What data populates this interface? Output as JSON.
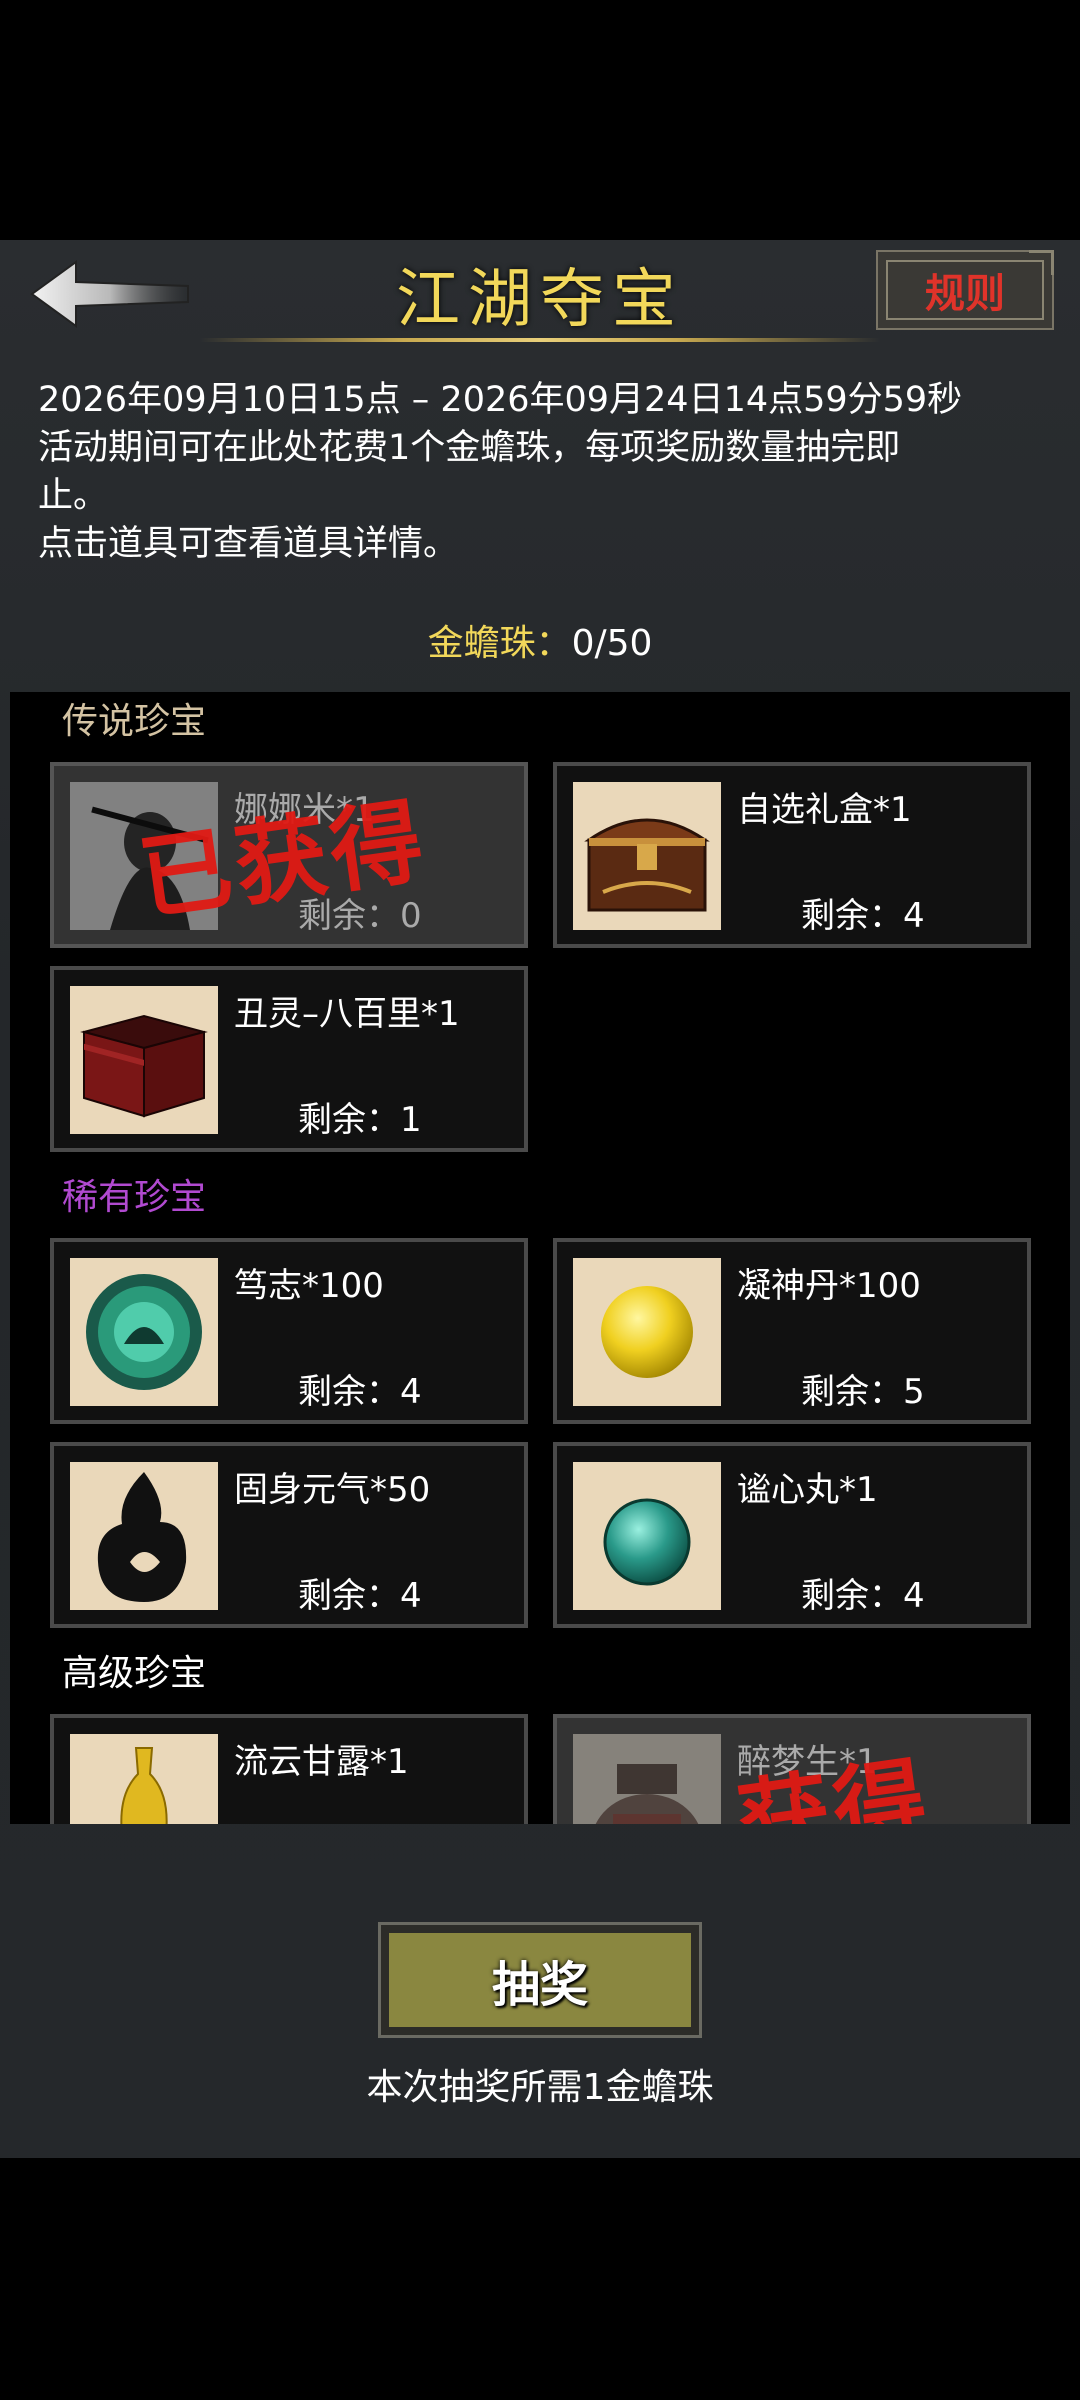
{
  "header": {
    "title": "江湖夺宝",
    "rules_label": "规则"
  },
  "info": {
    "date_range": "2026年09月10日15点 – 2026年09月24日14点59分59秒",
    "desc_line1": "活动期间可在此处花费1个金蟾珠，每项奖励数量抽完即",
    "desc_line2": "止。",
    "tip": "点击道具可查看道具详情。"
  },
  "currency": {
    "label": "金蟾珠：",
    "value": "0/50"
  },
  "sections": {
    "legend": {
      "title": "传说珍宝",
      "color": "#d4c3a3",
      "items": [
        {
          "name": "娜娜米*1",
          "remain": "剩余：0",
          "stamp": "已获得",
          "icon": "ninja-portrait"
        },
        {
          "name": "自选礼盒*1",
          "remain": "剩余：4",
          "icon": "treasure-chest"
        },
        {
          "name": "丑灵–八百里*1",
          "remain": "剩余：1",
          "icon": "red-box"
        }
      ]
    },
    "rare": {
      "title": "稀有珍宝",
      "color": "#b14ad0",
      "items": [
        {
          "name": "笃志*100",
          "remain": "剩余：4",
          "icon": "jade-orb"
        },
        {
          "name": "凝神丹*100",
          "remain": "剩余：5",
          "icon": "gold-pill"
        },
        {
          "name": "固身元气*50",
          "remain": "剩余：4",
          "icon": "black-flame"
        },
        {
          "name": "谧心丸*1",
          "remain": "剩余：4",
          "icon": "teal-pill"
        }
      ]
    },
    "advanced": {
      "title": "高级珍宝",
      "color": "#ffffff",
      "items": [
        {
          "name": "流云甘露*1",
          "icon": "gold-bottle"
        },
        {
          "name": "醉梦生*1",
          "stamp": "获得",
          "icon": "wine-jar"
        }
      ]
    }
  },
  "draw": {
    "button_label": "抽奖",
    "note": "本次抽奖所需1金蟾珠"
  }
}
